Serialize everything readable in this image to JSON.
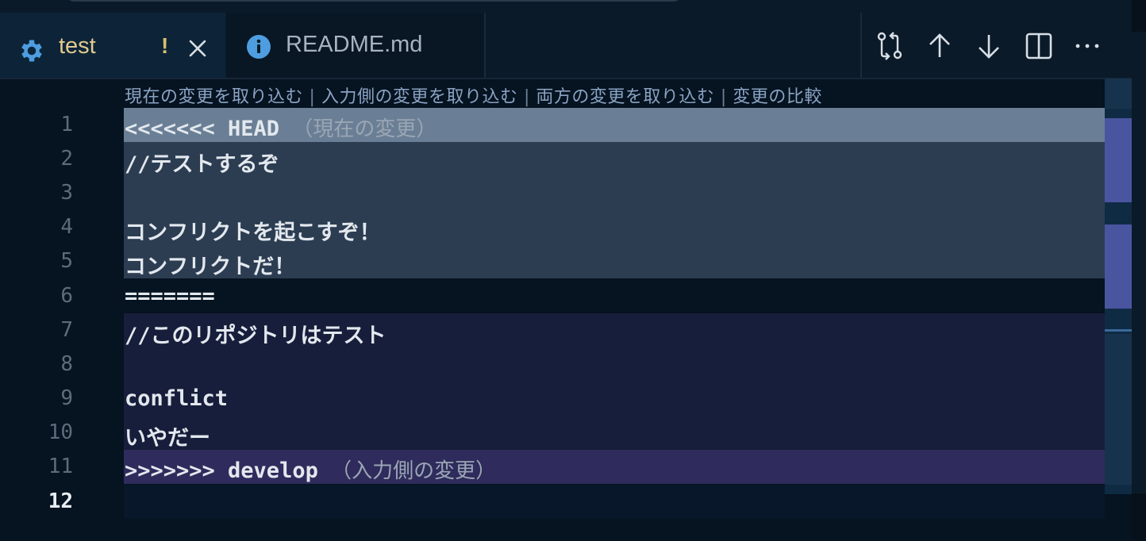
{
  "tabs": [
    {
      "label": "test",
      "modified_indicator": "!",
      "active": true,
      "icon": "gear-icon"
    },
    {
      "label": "README.md",
      "active": false,
      "icon": "info-icon"
    }
  ],
  "editor_actions": [
    "compare-changes-icon",
    "arrow-up-icon",
    "arrow-down-icon",
    "split-editor-icon",
    "more-actions-icon"
  ],
  "codelens": {
    "accept_current": "現在の変更を取り込む",
    "accept_incoming": "入力側の変更を取り込む",
    "accept_both": "両方の変更を取り込む",
    "compare": "変更の比較",
    "separator": "|"
  },
  "lines": [
    {
      "number": "1",
      "text": "<<<<<<< HEAD",
      "annotation": "（現在の変更）",
      "kind": "current-header"
    },
    {
      "number": "2",
      "text": "//テストするぞ",
      "kind": "current"
    },
    {
      "number": "3",
      "text": "",
      "kind": "current"
    },
    {
      "number": "4",
      "text": "コンフリクトを起こすぞ！",
      "kind": "current"
    },
    {
      "number": "5",
      "text": "コンフリクトだ！",
      "kind": "current"
    },
    {
      "number": "6",
      "text": "=======",
      "kind": "separator"
    },
    {
      "number": "7",
      "text": "//このリポジトリはテスト",
      "kind": "incoming"
    },
    {
      "number": "8",
      "text": "",
      "kind": "incoming"
    },
    {
      "number": "9",
      "text": "conflict",
      "kind": "incoming"
    },
    {
      "number": "10",
      "text": "いやだー",
      "kind": "incoming"
    },
    {
      "number": "11",
      "text": ">>>>>>> develop",
      "annotation": "（入力側の変更）",
      "kind": "incoming-header"
    },
    {
      "number": "12",
      "text": "",
      "kind": "cursor"
    }
  ],
  "colors": {
    "current_header": "#6a7f95",
    "current": "#2c3d52",
    "incoming": "#171e3b",
    "incoming_header": "#2f2b5c",
    "accent_blue": "#4d9de0",
    "modified": "#d9c06b"
  }
}
